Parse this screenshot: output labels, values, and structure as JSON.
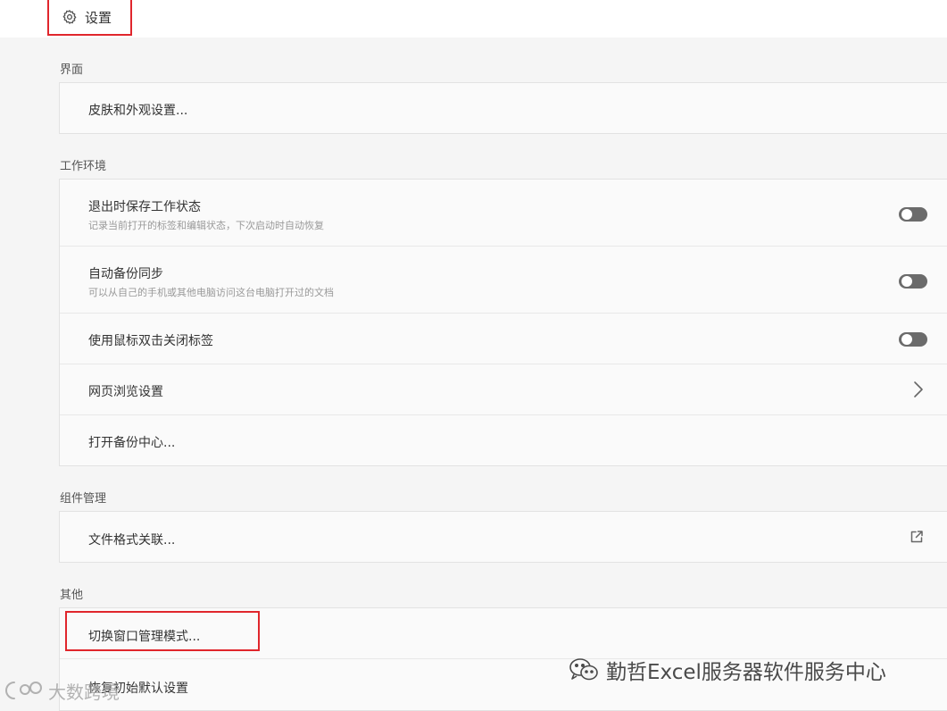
{
  "header": {
    "title": "设置"
  },
  "sections": {
    "interface": {
      "label": "界面",
      "items": [
        {
          "title": "皮肤和外观设置..."
        }
      ]
    },
    "workspace": {
      "label": "工作环境",
      "items": [
        {
          "title": "退出时保存工作状态",
          "subtitle": "记录当前打开的标签和编辑状态，下次启动时自动恢复",
          "control": "toggle",
          "enabled": false
        },
        {
          "title": "自动备份同步",
          "subtitle": "可以从自己的手机或其他电脑访问这台电脑打开过的文档",
          "control": "toggle",
          "enabled": false
        },
        {
          "title": "使用鼠标双击关闭标签",
          "control": "toggle",
          "enabled": false
        },
        {
          "title": "网页浏览设置",
          "control": "chevron-right-icon"
        },
        {
          "title": "打开备份中心..."
        }
      ]
    },
    "components": {
      "label": "组件管理",
      "items": [
        {
          "title": "文件格式关联...",
          "control": "external-link-icon"
        }
      ]
    },
    "other": {
      "label": "其他",
      "items": [
        {
          "title": "切换窗口管理模式..."
        },
        {
          "title": "恢复初始默认设置"
        }
      ]
    }
  },
  "watermarks": {
    "right": "勤哲Excel服务器软件服务中心",
    "left": "大数跨境"
  },
  "colors": {
    "highlight": "#e0262c",
    "toggle_off": "#6b6b6b",
    "background": "#f5f5f5",
    "card": "#fafafa"
  }
}
